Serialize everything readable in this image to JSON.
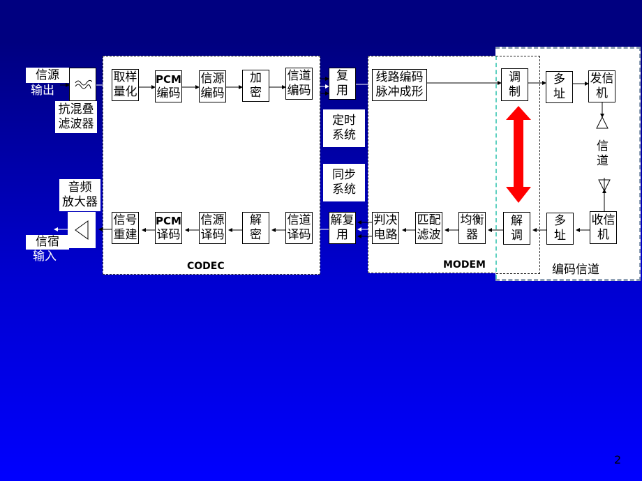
{
  "panels": {
    "codec_label": "CODEC",
    "modem_label": "MODEM",
    "channel_label": "编码信道"
  },
  "left": {
    "source_output_top": "信源",
    "source_output_bottom": "输出",
    "antialias_filter": "抗混叠\n滤波器",
    "audio_amp": "音频\n放大器",
    "sink_input_top": "信宿",
    "sink_input_bottom": "输入"
  },
  "tx_chain": [
    {
      "id": "sample-quantize",
      "label": "取样\n量化"
    },
    {
      "id": "pcm-encode",
      "label_top": "PCM",
      "label_bottom": "编码"
    },
    {
      "id": "source-encode",
      "label": "信源\n编码"
    },
    {
      "id": "encrypt",
      "label": "加\n密"
    },
    {
      "id": "channel-encode",
      "label": "信道\n编码"
    },
    {
      "id": "multiplex",
      "label": "复\n用"
    },
    {
      "id": "line-code",
      "label": "线路编码\n脉冲成形"
    },
    {
      "id": "modulate",
      "label": "调\n制"
    },
    {
      "id": "multi-access-tx",
      "label": "多\n址"
    },
    {
      "id": "transmitter",
      "label": "发信\n机"
    }
  ],
  "rx_chain": [
    {
      "id": "signal-rebuild",
      "label": "信号\n重建"
    },
    {
      "id": "pcm-decode",
      "label_top": "PCM",
      "label_bottom": "译码"
    },
    {
      "id": "source-decode",
      "label": "信源\n译码"
    },
    {
      "id": "decrypt",
      "label": "解\n密"
    },
    {
      "id": "channel-decode",
      "label": "信道\n译码"
    },
    {
      "id": "demultiplex",
      "label": "解复\n用"
    },
    {
      "id": "decision",
      "label": "判决\n电路"
    },
    {
      "id": "matched-filter",
      "label": "匹配\n滤波"
    },
    {
      "id": "equalizer",
      "label": "均衡\n器"
    },
    {
      "id": "demodulate",
      "label": "解\n调"
    },
    {
      "id": "multi-access-rx",
      "label": "多\n址"
    },
    {
      "id": "receiver",
      "label": "收信\n机"
    }
  ],
  "middle": {
    "timing": "定时\n系统",
    "sync": "同步\n系统"
  },
  "channel": "信\n道",
  "colors": {
    "bg_top": "#000080",
    "bg_bottom": "#0000FF",
    "arrow_red": "#FF0000",
    "channel_border": "#8EA0B4",
    "teal_dash": "#5FD0C0"
  },
  "page_number": "2"
}
